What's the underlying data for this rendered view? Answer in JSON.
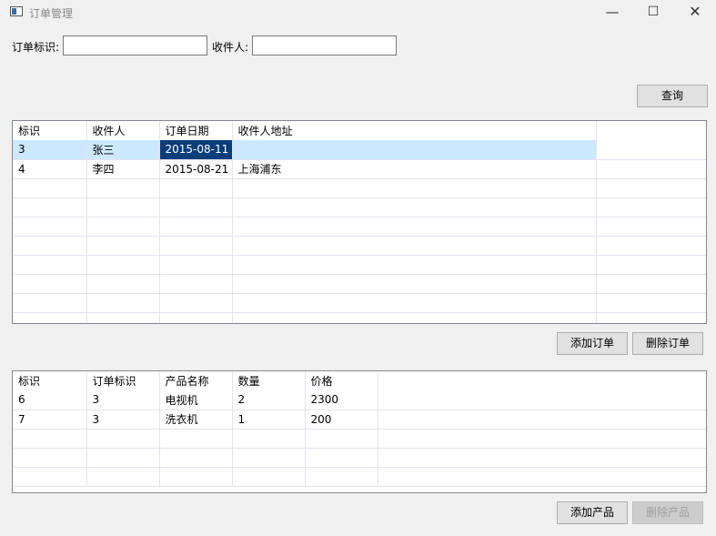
{
  "window": {
    "title": "订单管理",
    "minimize": "—",
    "maximize": "☐",
    "close": "✕"
  },
  "filter": {
    "order_id_label": "订单标识:",
    "order_id_value": "",
    "recipient_label": "收件人:",
    "recipient_value": "",
    "query_button": "查询"
  },
  "orders": {
    "columns": [
      "标识",
      "收件人",
      "订单日期",
      "收件人地址"
    ],
    "rows": [
      [
        "3",
        "张三",
        "2015-08-11",
        ""
      ],
      [
        "4",
        "李四",
        "2015-08-21",
        "上海浦东"
      ]
    ],
    "add_button": "添加订单",
    "delete_button": "删除订单"
  },
  "products": {
    "columns": [
      "标识",
      "订单标识",
      "产品名称",
      "数量",
      "价格"
    ],
    "rows": [
      [
        "6",
        "3",
        "电视机",
        "2",
        "2300"
      ],
      [
        "7",
        "3",
        "洗衣机",
        "1",
        "200"
      ]
    ],
    "add_button": "添加产品",
    "delete_button": "删除产品"
  }
}
